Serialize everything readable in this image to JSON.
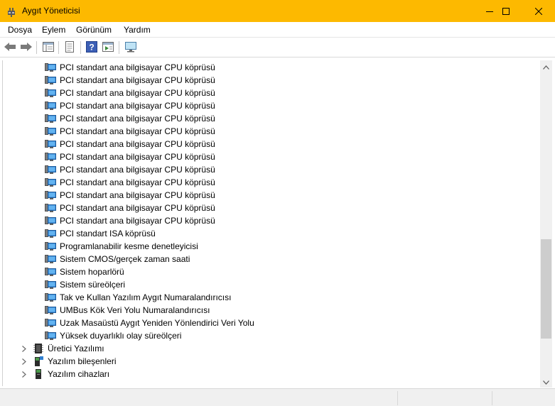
{
  "window": {
    "title": "Aygıt Yöneticisi",
    "title_bar_color": "#fdb900",
    "controls": [
      "minimize-icon",
      "maximize-icon",
      "close-icon"
    ]
  },
  "menu": {
    "items": [
      "Dosya",
      "Eylem",
      "Görünüm",
      "Yardım"
    ]
  },
  "toolbar": {
    "buttons": [
      "back-icon",
      "forward-icon",
      "show-hide-tree-icon",
      "properties-icon",
      "help-icon",
      "run-icon",
      "monitor-icon"
    ]
  },
  "tree": {
    "device_icon": "system-device-icon",
    "children": [
      "PCI standart ana bilgisayar CPU köprüsü",
      "PCI standart ana bilgisayar CPU köprüsü",
      "PCI standart ana bilgisayar CPU köprüsü",
      "PCI standart ana bilgisayar CPU köprüsü",
      "PCI standart ana bilgisayar CPU köprüsü",
      "PCI standart ana bilgisayar CPU köprüsü",
      "PCI standart ana bilgisayar CPU köprüsü",
      "PCI standart ana bilgisayar CPU köprüsü",
      "PCI standart ana bilgisayar CPU köprüsü",
      "PCI standart ana bilgisayar CPU köprüsü",
      "PCI standart ana bilgisayar CPU köprüsü",
      "PCI standart ana bilgisayar CPU köprüsü",
      "PCI standart ana bilgisayar CPU köprüsü",
      "PCI standart ISA köprüsü",
      "Programlanabilir kesme denetleyicisi",
      "Sistem CMOS/gerçek zaman saati",
      "Sistem hoparlörü",
      "Sistem süreölçeri",
      "Tak ve Kullan Yazılım Aygıt Numaralandırıcısı",
      "UMBus Kök Veri Yolu Numaralandırıcısı",
      "Uzak Masaüstü Aygıt Yeniden Yönlendirici Veri Yolu",
      "Yüksek duyarlıklı olay süreölçeri"
    ],
    "categories": [
      {
        "label": "Üretici Yazılımı",
        "icon": "firmware-icon",
        "expanded": false
      },
      {
        "label": "Yazılım bileşenleri",
        "icon": "software-component-icon",
        "expanded": false
      },
      {
        "label": "Yazılım cihazları",
        "icon": "software-device-icon",
        "expanded": false
      }
    ]
  },
  "scrollbar": {
    "position_fraction": 0.82
  }
}
